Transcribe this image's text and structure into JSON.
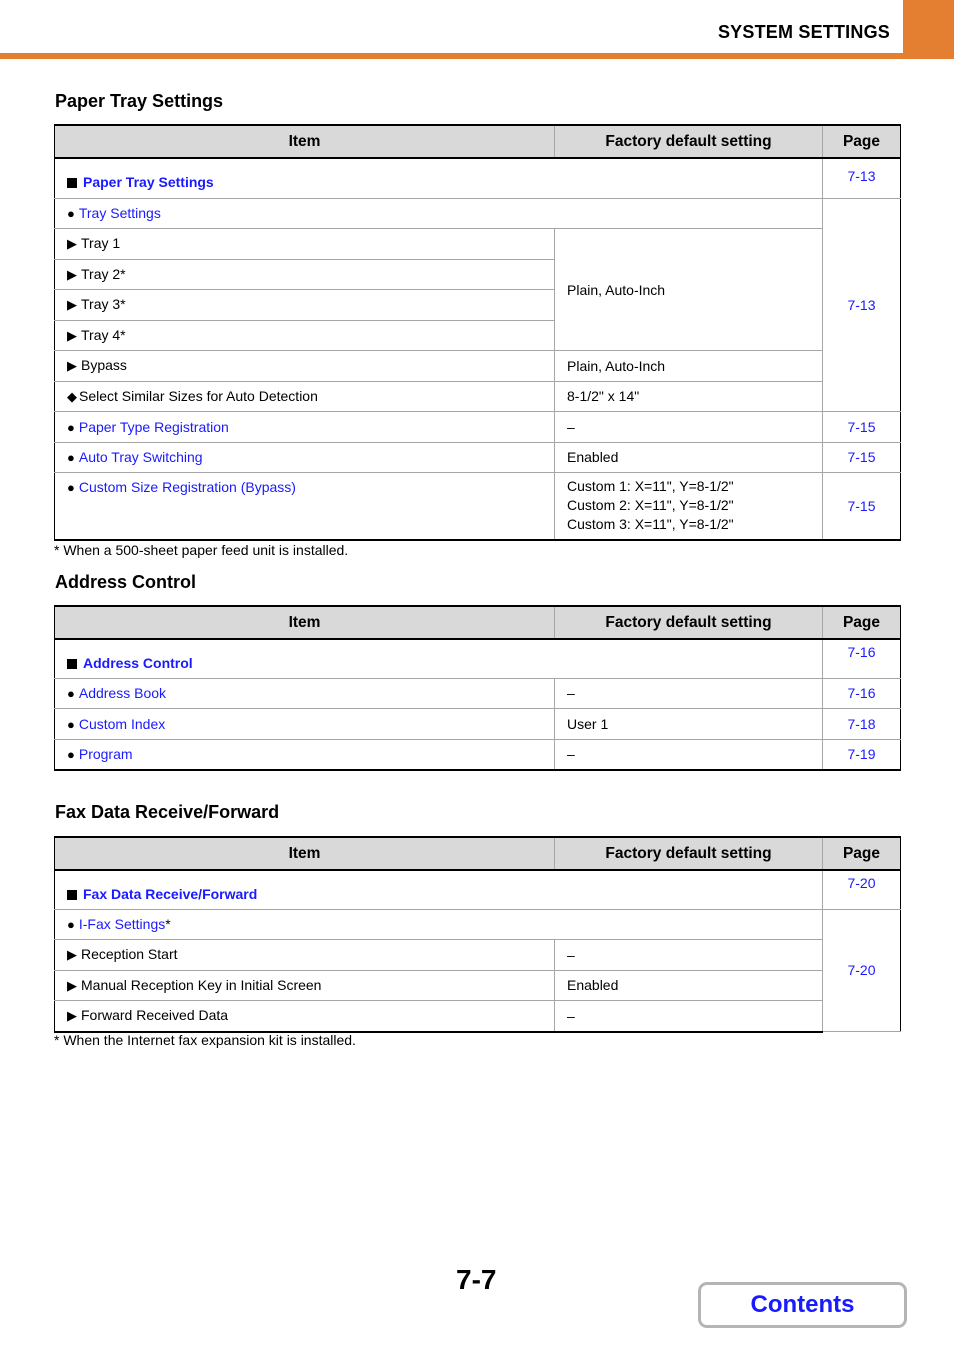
{
  "header": {
    "title": "SYSTEM SETTINGS",
    "accent_color": "#e47f32"
  },
  "columns": {
    "item": "Item",
    "default": "Factory default setting",
    "page": "Page"
  },
  "paper_tray": {
    "title": "Paper Tray Settings",
    "heading": {
      "label": "Paper Tray Settings",
      "page": "7-13"
    },
    "tray_settings": {
      "label": "Tray Settings",
      "page": "7-13"
    },
    "trays": [
      "Tray 1",
      "Tray 2*",
      "Tray 3*",
      "Tray 4*"
    ],
    "trays_default": "Plain, Auto-Inch",
    "bypass": {
      "label": "Bypass",
      "default": "Plain, Auto-Inch"
    },
    "similar_sizes": {
      "label": "Select Similar Sizes for Auto Detection",
      "default": "8-1/2\" x 14\""
    },
    "paper_type": {
      "label": "Paper Type Registration",
      "default": "–",
      "page": "7-15"
    },
    "auto_tray": {
      "label": "Auto Tray Switching",
      "default": "Enabled",
      "page": "7-15"
    },
    "custom_size": {
      "label": "Custom Size Registration (Bypass)",
      "defaults": [
        "Custom 1: X=11\", Y=8-1/2\"",
        "Custom 2: X=11\", Y=8-1/2\"",
        "Custom 3: X=11\", Y=8-1/2\""
      ],
      "page": "7-15"
    },
    "footnote": "*  When a 500-sheet paper feed unit is installed."
  },
  "address_control": {
    "title": "Address Control",
    "heading": {
      "label": "Address Control",
      "page": "7-16"
    },
    "rows": [
      {
        "label": "Address Book",
        "default": "–",
        "page": "7-16"
      },
      {
        "label": "Custom Index",
        "default": "User 1",
        "page": "7-18"
      },
      {
        "label": "Program",
        "default": "–",
        "page": "7-19"
      }
    ]
  },
  "fax_data": {
    "title": "Fax Data Receive/Forward",
    "heading": {
      "label": "Fax Data Receive/Forward",
      "page": "7-20"
    },
    "ifax": {
      "label": "I-Fax Settings",
      "suffix": "*",
      "page": "7-20"
    },
    "rows": [
      {
        "label": "Reception Start",
        "default": "–"
      },
      {
        "label": "Manual Reception Key in Initial Screen",
        "default": "Enabled"
      },
      {
        "label": "Forward Received Data",
        "default": "–"
      }
    ],
    "footnote": "*  When the Internet fax expansion kit is installed."
  },
  "footer": {
    "page_number": "7-7",
    "contents_label": "Contents"
  }
}
